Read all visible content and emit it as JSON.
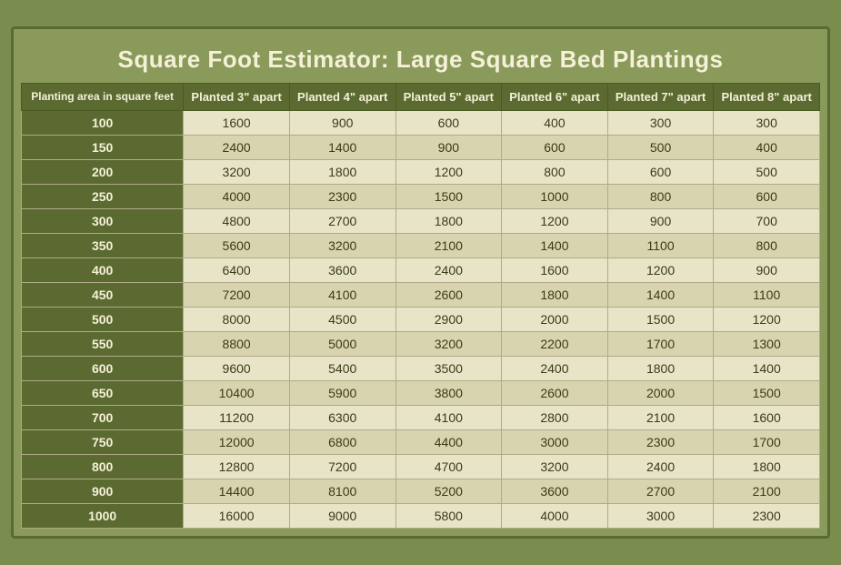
{
  "title": "Square Foot Estimator: Large Square Bed Plantings",
  "headers": [
    "Planting area in square feet",
    "Planted 3\" apart",
    "Planted 4\" apart",
    "Planted 5\" apart",
    "Planted 6\" apart",
    "Planted 7\" apart",
    "Planted 8\" apart"
  ],
  "rows": [
    [
      "100",
      "1600",
      "900",
      "600",
      "400",
      "300",
      "300"
    ],
    [
      "150",
      "2400",
      "1400",
      "900",
      "600",
      "500",
      "400"
    ],
    [
      "200",
      "3200",
      "1800",
      "1200",
      "800",
      "600",
      "500"
    ],
    [
      "250",
      "4000",
      "2300",
      "1500",
      "1000",
      "800",
      "600"
    ],
    [
      "300",
      "4800",
      "2700",
      "1800",
      "1200",
      "900",
      "700"
    ],
    [
      "350",
      "5600",
      "3200",
      "2100",
      "1400",
      "1100",
      "800"
    ],
    [
      "400",
      "6400",
      "3600",
      "2400",
      "1600",
      "1200",
      "900"
    ],
    [
      "450",
      "7200",
      "4100",
      "2600",
      "1800",
      "1400",
      "1100"
    ],
    [
      "500",
      "8000",
      "4500",
      "2900",
      "2000",
      "1500",
      "1200"
    ],
    [
      "550",
      "8800",
      "5000",
      "3200",
      "2200",
      "1700",
      "1300"
    ],
    [
      "600",
      "9600",
      "5400",
      "3500",
      "2400",
      "1800",
      "1400"
    ],
    [
      "650",
      "10400",
      "5900",
      "3800",
      "2600",
      "2000",
      "1500"
    ],
    [
      "700",
      "11200",
      "6300",
      "4100",
      "2800",
      "2100",
      "1600"
    ],
    [
      "750",
      "12000",
      "6800",
      "4400",
      "3000",
      "2300",
      "1700"
    ],
    [
      "800",
      "12800",
      "7200",
      "4700",
      "3200",
      "2400",
      "1800"
    ],
    [
      "900",
      "14400",
      "8100",
      "5200",
      "3600",
      "2700",
      "2100"
    ],
    [
      "1000",
      "16000",
      "9000",
      "5800",
      "4000",
      "3000",
      "2300"
    ]
  ]
}
